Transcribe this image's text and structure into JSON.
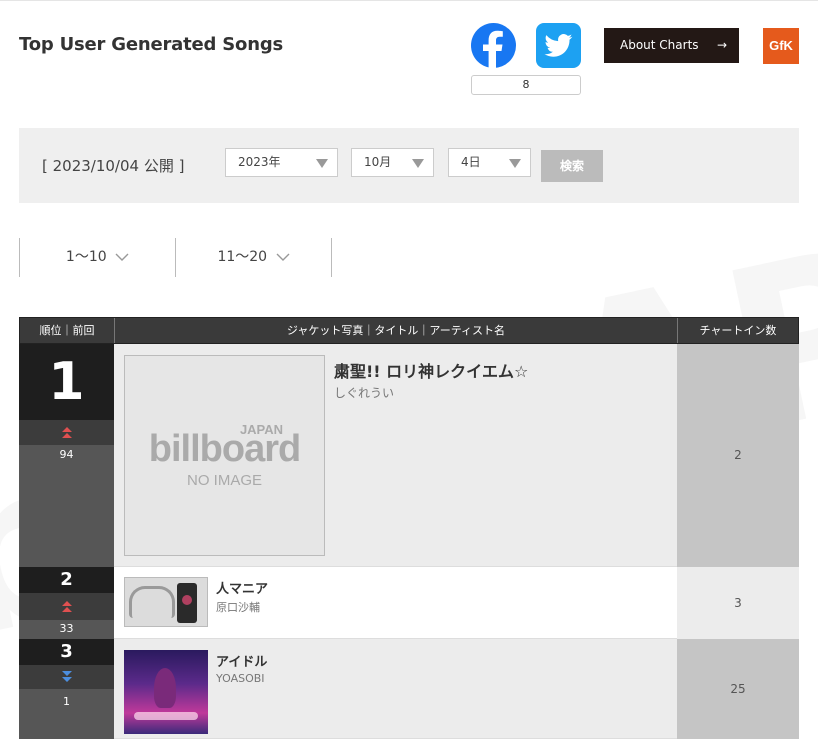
{
  "header": {
    "title": "Top User Generated Songs",
    "share_count": "8",
    "about_label": "About Charts",
    "about_arrow": "→",
    "partner_logo": "GfK"
  },
  "date_panel": {
    "published": "[ 2023/10/04 公開 ]",
    "year": "2023年",
    "month": "10月",
    "day": "4日",
    "search_label": "検索"
  },
  "range_tabs": [
    {
      "label": "1〜10"
    },
    {
      "label": "11〜20"
    }
  ],
  "table": {
    "col_rank": "順位｜前回",
    "col_info": "ジャケット写真｜タイトル｜アーティスト名",
    "col_weeks": "チャートイン数",
    "rows": [
      {
        "rank": "1",
        "prev": "94",
        "move": "up",
        "title": "粛聖!! ロリ神レクイエム☆",
        "artist": "しぐれうい",
        "weeks": "2",
        "jacket": "no-image"
      },
      {
        "rank": "2",
        "prev": "33",
        "move": "up",
        "title": "人マニア",
        "artist": "原口沙輔",
        "weeks": "3",
        "jacket": "photo"
      },
      {
        "rank": "3",
        "prev": "1",
        "move": "down",
        "title": "アイドル",
        "artist": "YOASOBI",
        "weeks": "25",
        "jacket": "photo"
      }
    ]
  },
  "placeholder": {
    "brand_top": "JAPAN",
    "brand": "billboard",
    "no_image": "NO IMAGE"
  },
  "colors": {
    "facebook": "#1877f2",
    "twitter": "#1da1f2",
    "up_arrow": "#e05050",
    "down_arrow": "#4c8fe0"
  }
}
